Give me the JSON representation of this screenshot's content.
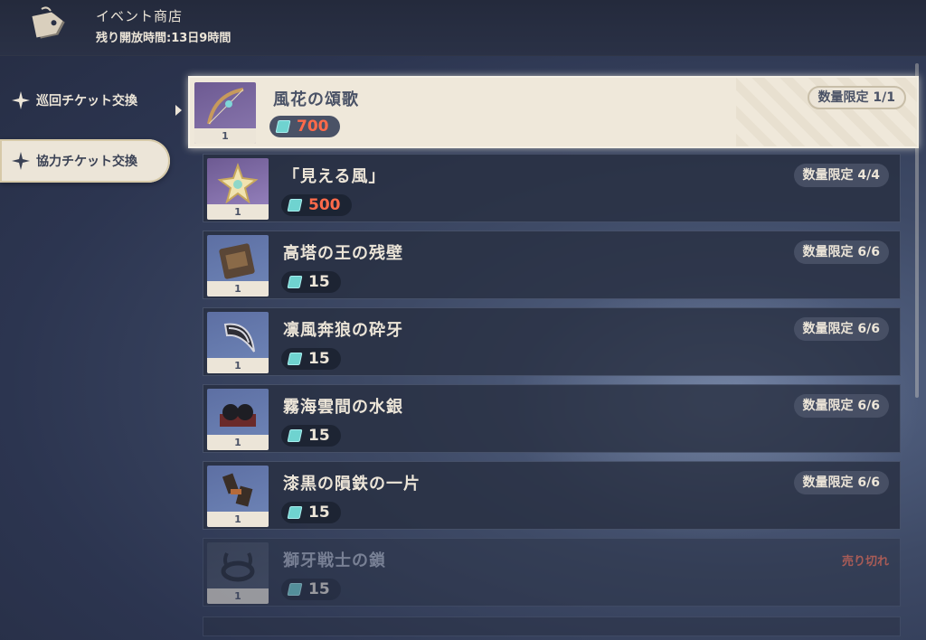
{
  "header": {
    "title": "イベント商店",
    "timer": "残り開放時間:13日9時間"
  },
  "tabs": [
    {
      "label": "巡回チケット交換",
      "active": false
    },
    {
      "label": "協力チケット交換",
      "active": true
    }
  ],
  "items": [
    {
      "name": "風花の頌歌",
      "price": "700",
      "limit": "数量限定 1/1",
      "quantity": "1",
      "icon": "bow-icon",
      "selected": true
    },
    {
      "name": "「見える風」",
      "price": "500",
      "limit": "数量限定 4/4",
      "quantity": "1",
      "icon": "wind-flower-icon"
    },
    {
      "name": "高塔の王の残壁",
      "price": "15",
      "limit": "数量限定 6/6",
      "quantity": "1",
      "icon": "wall-icon"
    },
    {
      "name": "凛風奔狼の砕牙",
      "price": "15",
      "limit": "数量限定 6/6",
      "quantity": "1",
      "icon": "fang-icon"
    },
    {
      "name": "霧海雲間の水銀",
      "price": "15",
      "limit": "数量限定 6/6",
      "quantity": "1",
      "icon": "mercury-icon"
    },
    {
      "name": "漆黒の隕鉄の一片",
      "price": "15",
      "limit": "数量限定 6/6",
      "quantity": "1",
      "icon": "meteorite-icon"
    },
    {
      "name": "獅牙戦士の鎖",
      "price": "15",
      "limit": "売り切れ",
      "quantity": "1",
      "icon": "chain-icon",
      "sold_out": true
    }
  ],
  "colors": {
    "accent_red": "#ff6a4a",
    "cream": "#ece5d8",
    "ticket": "#6fd3d0"
  }
}
